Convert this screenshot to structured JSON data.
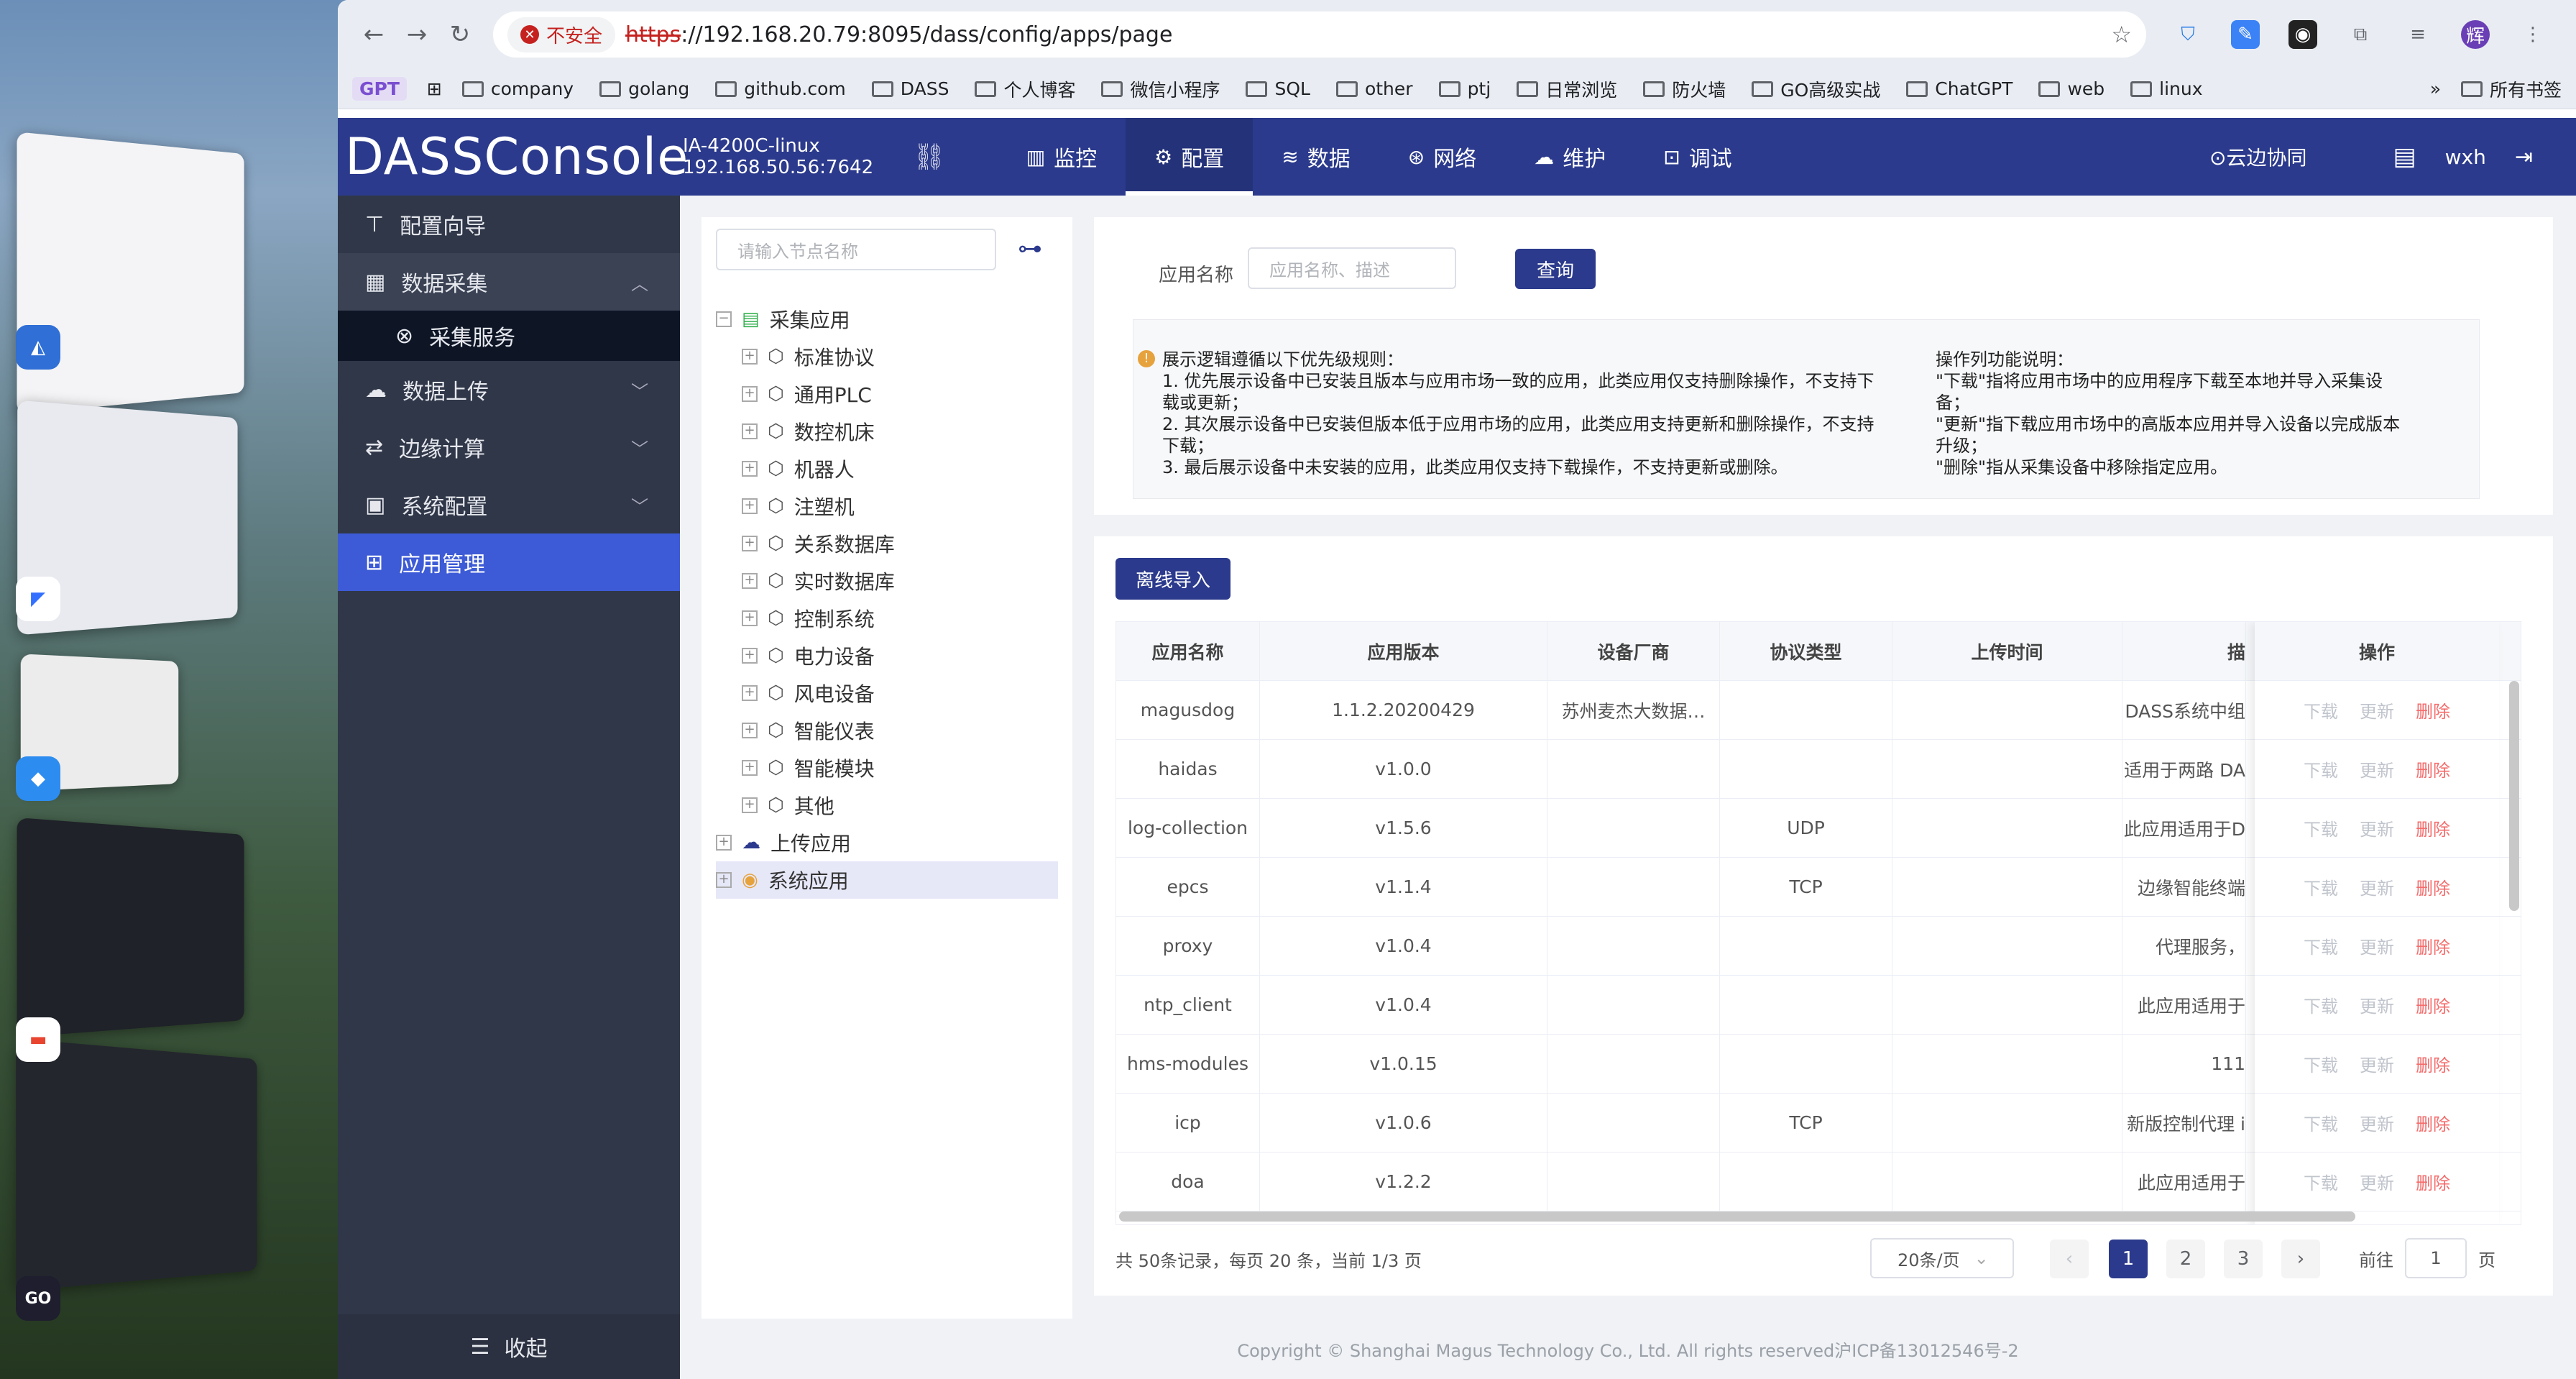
{
  "browser": {
    "insecure_label": "不安全",
    "url_scheme": "https",
    "url_rest": "://192.168.20.79:8095/dass/config/apps/page",
    "profile_letter": "辉"
  },
  "bookmarks": [
    {
      "label": "company"
    },
    {
      "label": "golang"
    },
    {
      "label": "github.com"
    },
    {
      "label": "DASS"
    },
    {
      "label": "个人博客"
    },
    {
      "label": "微信小程序"
    },
    {
      "label": "SQL"
    },
    {
      "label": "other"
    },
    {
      "label": "ptj"
    },
    {
      "label": "日常浏览"
    },
    {
      "label": "防火墙"
    },
    {
      "label": "GO高级实战"
    },
    {
      "label": "ChatGPT"
    },
    {
      "label": "web"
    },
    {
      "label": "linux"
    }
  ],
  "bookmarks_gpt": "GPT",
  "bookmarks_more": "»",
  "bookmarks_all": "所有书签",
  "header": {
    "logo": "DASSConsole",
    "device_name": "IA-4200C-linux",
    "device_ip": "192.168.50.56:7642",
    "nav": [
      {
        "label": "监控",
        "icon": "monitor-icon"
      },
      {
        "label": "配置",
        "icon": "gear-icon"
      },
      {
        "label": "数据",
        "icon": "database-icon"
      },
      {
        "label": "网络",
        "icon": "network-icon"
      },
      {
        "label": "维护",
        "icon": "cloud-icon"
      },
      {
        "label": "调试",
        "icon": "debug-icon"
      }
    ],
    "cloud_label": "⊙云边协同",
    "user": "wxh"
  },
  "sidebar": {
    "items": [
      {
        "label": "配置向导"
      },
      {
        "label": "数据采集"
      },
      {
        "label": "采集服务"
      },
      {
        "label": "数据上传"
      },
      {
        "label": "边缘计算"
      },
      {
        "label": "系统配置"
      },
      {
        "label": "应用管理"
      }
    ],
    "collapse_label": "收起"
  },
  "tree": {
    "search_placeholder": "请输入节点名称",
    "root": "采集应用",
    "children": [
      "标准协议",
      "通用PLC",
      "数控机床",
      "机器人",
      "注塑机",
      "关系数据库",
      "实时数据库",
      "控制系统",
      "电力设备",
      "风电设备",
      "智能仪表",
      "智能模块",
      "其他"
    ],
    "upload": "上传应用",
    "system": "系统应用"
  },
  "query": {
    "label": "应用名称",
    "placeholder": "应用名称、描述",
    "button": "查询"
  },
  "notice": {
    "left_title": "展示逻辑遵循以下优先级规则：",
    "left_lines": [
      "1. 优先展示设备中已安装且版本与应用市场一致的应用，此类应用仅支持删除操作，不支持下载或更新；",
      "2. 其次展示设备中已安装但版本低于应用市场的应用，此类应用支持更新和删除操作，不支持下载；",
      "3. 最后展示设备中未安装的应用，此类应用仅支持下载操作，不支持更新或删除。"
    ],
    "right_title": "操作列功能说明：",
    "right_lines": [
      "\"下载\"指将应用市场中的应用程序下载至本地并导入采集设备；",
      "\"更新\"指下载应用市场中的高版本应用并导入设备以完成版本升级；",
      "\"删除\"指从采集设备中移除指定应用。"
    ]
  },
  "table": {
    "import_button": "离线导入",
    "columns": [
      "应用名称",
      "应用版本",
      "设备厂商",
      "协议类型",
      "上传时间",
      "描",
      "操作"
    ],
    "ops": {
      "download": "下载",
      "update": "更新",
      "delete": "删除"
    },
    "rows": [
      {
        "name": "magusdog",
        "version": "1.1.2.20200429",
        "vendor": "苏州麦杰大数据…",
        "protocol": "",
        "time": "",
        "desc": "DASS系统中组"
      },
      {
        "name": "haidas",
        "version": "v1.0.0",
        "vendor": "",
        "protocol": "",
        "time": "",
        "desc": "适用于两路 DA"
      },
      {
        "name": "log-collection",
        "version": "v1.5.6",
        "vendor": "",
        "protocol": "UDP",
        "time": "",
        "desc": "此应用适用于D"
      },
      {
        "name": "epcs",
        "version": "v1.1.4",
        "vendor": "",
        "protocol": "TCP",
        "time": "",
        "desc": "边缘智能终端"
      },
      {
        "name": "proxy",
        "version": "v1.0.4",
        "vendor": "",
        "protocol": "",
        "time": "",
        "desc": "代理服务，"
      },
      {
        "name": "ntp_client",
        "version": "v1.0.4",
        "vendor": "",
        "protocol": "",
        "time": "",
        "desc": "此应用适用于"
      },
      {
        "name": "hms-modules",
        "version": "v1.0.15",
        "vendor": "",
        "protocol": "",
        "time": "",
        "desc": "111"
      },
      {
        "name": "icp",
        "version": "v1.0.6",
        "vendor": "",
        "protocol": "TCP",
        "time": "",
        "desc": "新版控制代理 i"
      },
      {
        "name": "doa",
        "version": "v1.2.2",
        "vendor": "",
        "protocol": "",
        "time": "",
        "desc": "此应用适用于"
      }
    ]
  },
  "pager": {
    "summary": "共 50条记录，每页 20 条，当前 1/3 页",
    "page_size": "20条/页",
    "pages": [
      "1",
      "2",
      "3"
    ],
    "goto_label": "前往",
    "goto_value": "1",
    "goto_suffix": "页"
  },
  "footer": "Copyright © Shanghai Magus Technology Co., Ltd. All rights reserved沪ICP备13012546号-2",
  "colors": {
    "header": "#2b3a8c",
    "sidebar": "#303748",
    "selected": "#3d5bd6",
    "delete": "#f56c6c"
  }
}
